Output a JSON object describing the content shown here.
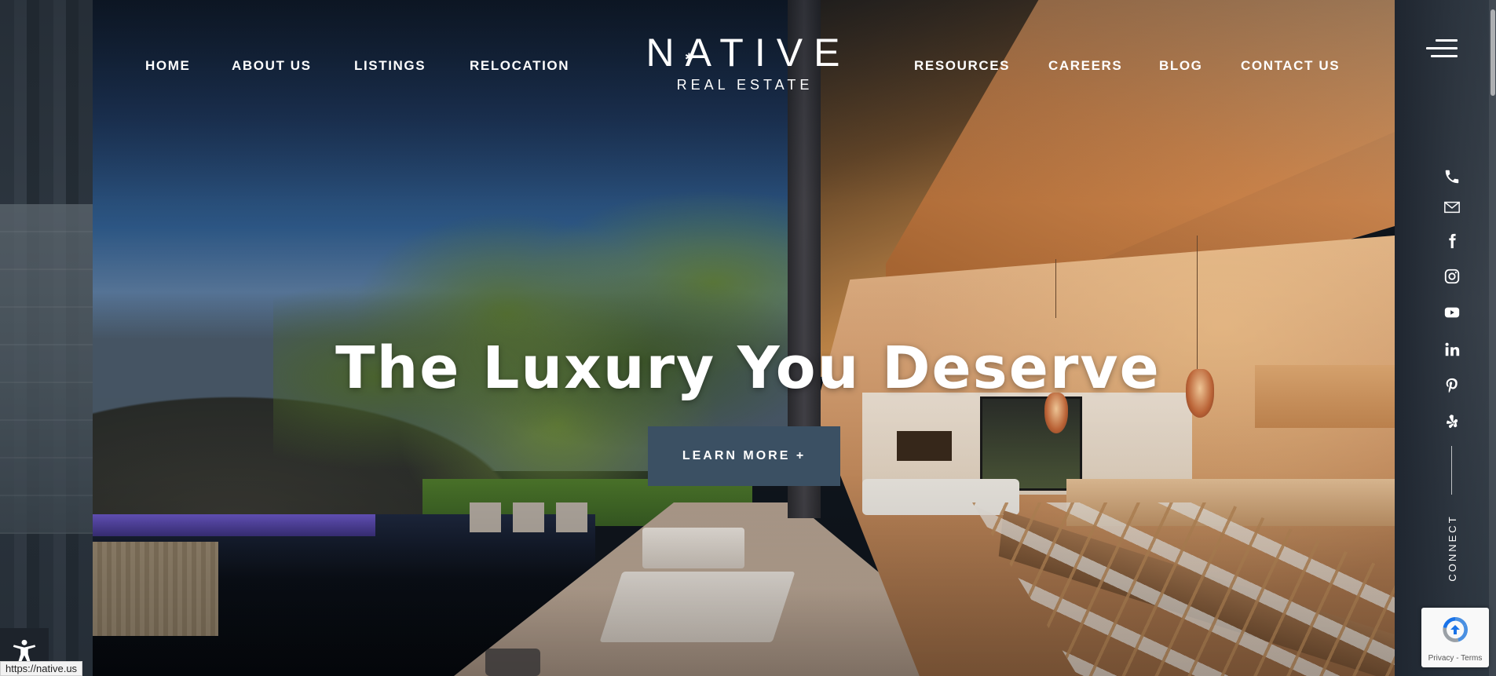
{
  "nav": {
    "left": [
      {
        "label": "HOME"
      },
      {
        "label": "ABOUT US"
      },
      {
        "label": "LISTINGS"
      },
      {
        "label": "RELOCATION"
      }
    ],
    "right": [
      {
        "label": "RESOURCES"
      },
      {
        "label": "CAREERS"
      },
      {
        "label": "BLOG"
      },
      {
        "label": "CONTACT US"
      }
    ]
  },
  "logo": {
    "main": "NATIVE",
    "sub": "REAL ESTATE"
  },
  "hero": {
    "title": "The Luxury You Deserve",
    "cta_label": "LEARN MORE +"
  },
  "sidebar": {
    "connect_label": "CONNECT",
    "icons": [
      "phone-icon",
      "mail-icon",
      "facebook-icon",
      "instagram-icon",
      "youtube-icon",
      "linkedin-icon",
      "pinterest-icon",
      "yelp-icon"
    ]
  },
  "recaptcha": {
    "privacy": "Privacy",
    "separator": " - ",
    "terms": "Terms"
  },
  "status_bar": {
    "url": "https://native.us"
  },
  "colors": {
    "cta_background": "#3b5063",
    "sidebar_background": "#1f2630",
    "text": "#ffffff"
  }
}
